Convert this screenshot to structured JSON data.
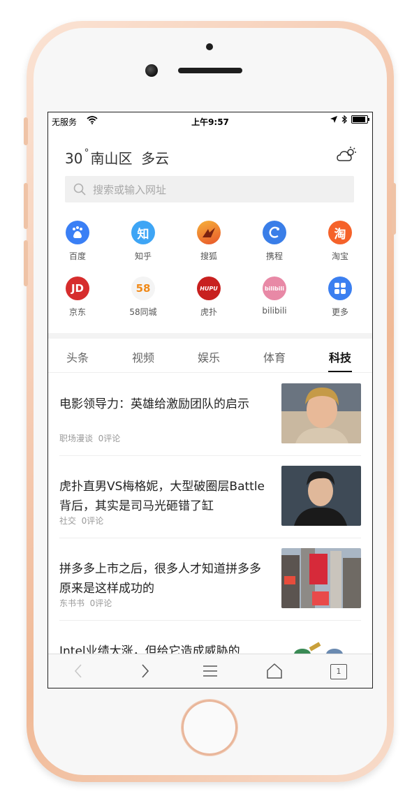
{
  "status_bar": {
    "carrier": "无服务",
    "time": "上午9:57"
  },
  "weather": {
    "temperature": "30",
    "degree_symbol": "°",
    "location_and_condition": "南山区  多云",
    "icon": "partly-cloudy-icon"
  },
  "search": {
    "placeholder": "搜索或输入网址"
  },
  "shortcuts": [
    {
      "label": "百度",
      "icon": "baidu-icon",
      "color": "#3a7ff5"
    },
    {
      "label": "知乎",
      "icon": "zhihu-icon",
      "glyph": "知",
      "color": "#3ea5f5"
    },
    {
      "label": "搜狐",
      "icon": "sohu-icon",
      "color": "#f08a2a"
    },
    {
      "label": "携程",
      "icon": "ctrip-icon",
      "color": "#3a7ee8"
    },
    {
      "label": "淘宝",
      "icon": "taobao-icon",
      "glyph": "淘",
      "color": "#f5622a"
    },
    {
      "label": "京东",
      "icon": "jd-icon",
      "glyph": "JD",
      "color": "#d62d2d"
    },
    {
      "label": "58同城",
      "icon": "58-icon",
      "glyph": "58",
      "color": "#f4f4f4"
    },
    {
      "label": "虎扑",
      "icon": "hupu-icon",
      "glyph": "HUPU",
      "color": "#c8201f"
    },
    {
      "label": "bilibili",
      "icon": "bilibili-icon",
      "glyph": "bilibili",
      "color": "#e889a6"
    },
    {
      "label": "更多",
      "icon": "more-apps-icon",
      "color": "#3b7ff0"
    }
  ],
  "tabs": [
    {
      "label": "头条",
      "active": false
    },
    {
      "label": "视频",
      "active": false
    },
    {
      "label": "娱乐",
      "active": false
    },
    {
      "label": "体育",
      "active": false
    },
    {
      "label": "科技",
      "active": true
    }
  ],
  "news": [
    {
      "title": "电影领导力：英雄给激励团队的启示",
      "source": "职场漫谈",
      "comments": "0评论"
    },
    {
      "title": "虎扑直男VS梅格妮，大型破圈层Battle背后，其实是司马光砸错了缸",
      "source": "社交",
      "comments": "0评论"
    },
    {
      "title": "拼多多上市之后，很多人才知道拼多多原来是这样成功的",
      "source": "东书书",
      "comments": "0评论"
    },
    {
      "title": "Intel业绩大涨，但给它造成威胁的",
      "source": "",
      "comments": ""
    }
  ],
  "toolbar": {
    "tab_count": "1"
  }
}
